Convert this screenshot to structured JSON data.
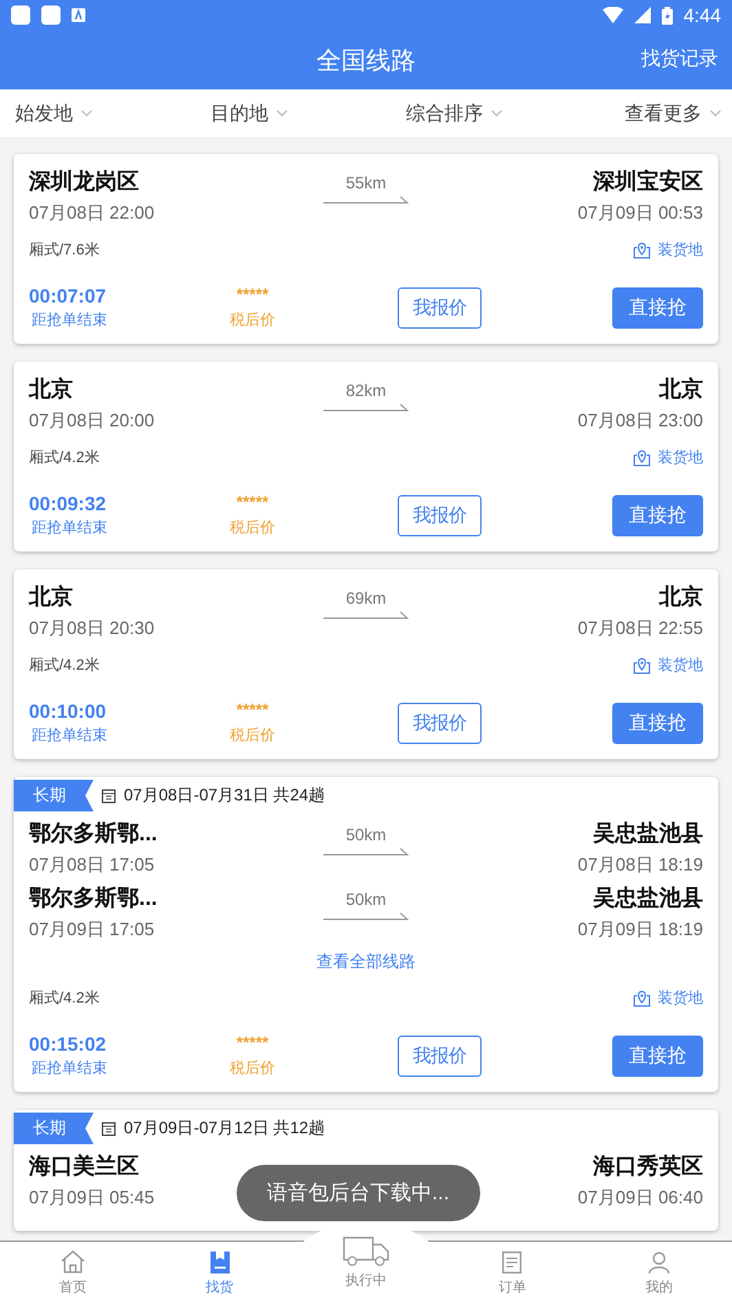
{
  "status_bar": {
    "time": "4:44"
  },
  "header": {
    "title": "全国线路",
    "action": "找货记录"
  },
  "filters": [
    {
      "label": "始发地"
    },
    {
      "label": "目的地"
    },
    {
      "label": "综合排序"
    },
    {
      "label": "查看更多"
    }
  ],
  "cards": [
    {
      "kind": "single",
      "routes": [
        {
          "from": "深圳龙岗区",
          "from_time": "07月08日 22:00",
          "distance": "55km",
          "to": "深圳宝安区",
          "to_time": "07月09日 00:53"
        }
      ],
      "truck": "厢式/7.6米",
      "load_label": "装货地",
      "countdown": "00:07:07",
      "countdown_label": "距抢单结束",
      "stars": "*****",
      "tax_label": "税后价",
      "quote_button": "我报价",
      "grab_button": "直接抢"
    },
    {
      "kind": "single",
      "routes": [
        {
          "from": "北京",
          "from_time": "07月08日 20:00",
          "distance": "82km",
          "to": "北京",
          "to_time": "07月08日 23:00"
        }
      ],
      "truck": "厢式/4.2米",
      "load_label": "装货地",
      "countdown": "00:09:32",
      "countdown_label": "距抢单结束",
      "stars": "*****",
      "tax_label": "税后价",
      "quote_button": "我报价",
      "grab_button": "直接抢"
    },
    {
      "kind": "single",
      "routes": [
        {
          "from": "北京",
          "from_time": "07月08日 20:30",
          "distance": "69km",
          "to": "北京",
          "to_time": "07月08日 22:55"
        }
      ],
      "truck": "厢式/4.2米",
      "load_label": "装货地",
      "countdown": "00:10:00",
      "countdown_label": "距抢单结束",
      "stars": "*****",
      "tax_label": "税后价",
      "quote_button": "我报价",
      "grab_button": "直接抢"
    },
    {
      "kind": "long",
      "tag": "长期",
      "schedule": "07月08日-07月31日 共24趟",
      "routes": [
        {
          "from": "鄂尔多斯鄂...",
          "from_time": "07月08日 17:05",
          "distance": "50km",
          "to": "吴忠盐池县",
          "to_time": "07月08日 18:19"
        },
        {
          "from": "鄂尔多斯鄂...",
          "from_time": "07月09日 17:05",
          "distance": "50km",
          "to": "吴忠盐池县",
          "to_time": "07月09日 18:19"
        }
      ],
      "view_all": "查看全部线路",
      "truck": "厢式/4.2米",
      "load_label": "装货地",
      "countdown": "00:15:02",
      "countdown_label": "距抢单结束",
      "stars": "*****",
      "tax_label": "税后价",
      "quote_button": "我报价",
      "grab_button": "直接抢"
    },
    {
      "kind": "long",
      "tag": "长期",
      "schedule": "07月09日-07月12日 共12趟",
      "routes": [
        {
          "from": "海口美兰区",
          "from_time": "07月09日 05:45",
          "to": "海口秀英区",
          "to_time": "07月09日 06:40"
        }
      ]
    }
  ],
  "toast": "语音包后台下载中...",
  "nav": {
    "tabs": [
      {
        "label": "首页",
        "kind": "home",
        "selected": false
      },
      {
        "label": "找货",
        "kind": "find",
        "selected": true
      },
      {
        "label": "执行中",
        "kind": "running",
        "selected": false
      },
      {
        "label": "订单",
        "kind": "orders",
        "selected": false
      },
      {
        "label": "我的",
        "kind": "mine",
        "selected": false
      }
    ]
  }
}
